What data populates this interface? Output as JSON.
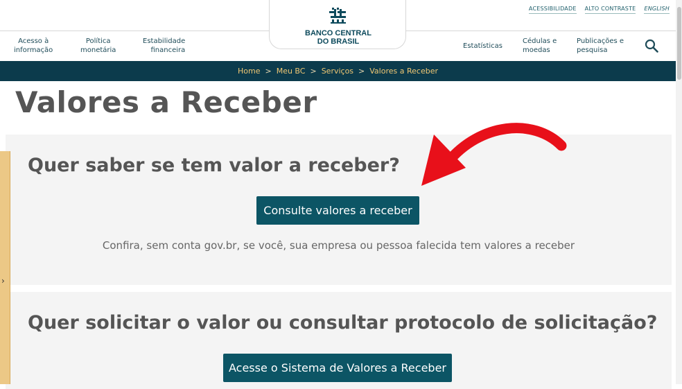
{
  "utility_links": [
    "ACESSIBILIDADE",
    "ALTO CONTRASTE",
    "ENGLISH"
  ],
  "logo": {
    "line1": "BANCO CENTRAL",
    "line2": "DO BRASIL"
  },
  "nav": {
    "left": [
      {
        "line1": "Acesso à",
        "line2": "informação"
      },
      {
        "line1": "Política",
        "line2": "monetária"
      },
      {
        "line1": "Estabilidade",
        "line2": "financeira"
      }
    ],
    "right": [
      {
        "line1": "Estatísticas",
        "line2": ""
      },
      {
        "line1": "Cédulas e",
        "line2": "moedas"
      },
      {
        "line1": "Publicações e",
        "line2": "pesquisa"
      }
    ]
  },
  "breadcrumb": [
    "Home",
    "Meu BC",
    "Serviços",
    "Valores a Receber"
  ],
  "page_title": "Valores a Receber",
  "section1": {
    "heading": "Quer saber se tem valor a receber?",
    "button": "Consulte valores a receber",
    "description": "Confira, sem conta gov.br, se você, sua empresa ou pessoa falecida tem valores a receber"
  },
  "section2": {
    "heading": "Quer solicitar o valor ou consultar protocolo de solicitação?",
    "button": "Acesse o Sistema de Valores a Receber"
  },
  "colors": {
    "header_bar": "#0c3b4c",
    "breadcrumb_text": "#f0c773",
    "button": "#0c5565",
    "arrow": "#e8101a",
    "side_tab": "#ecc886"
  }
}
